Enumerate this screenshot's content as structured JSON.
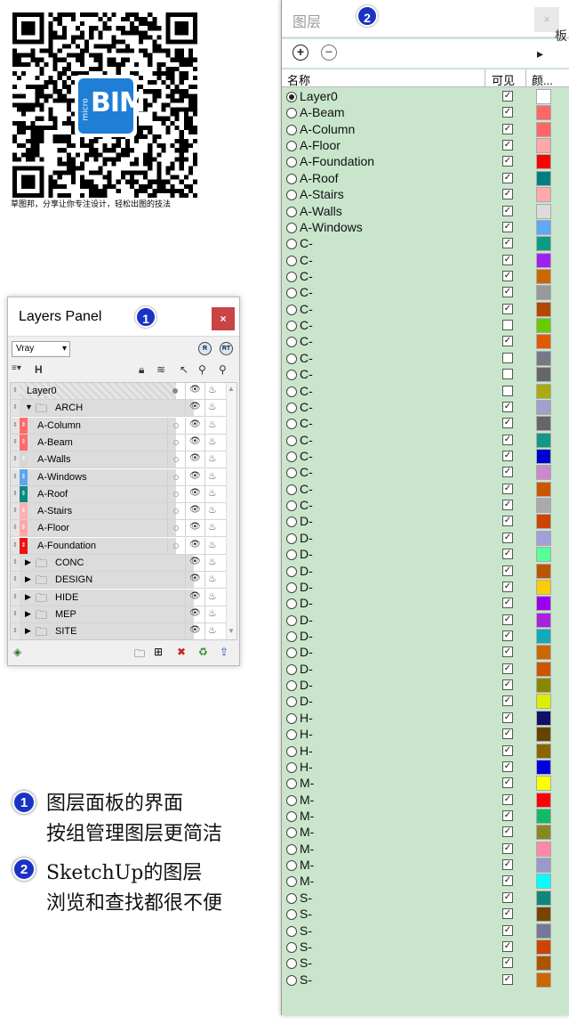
{
  "qr": {
    "logo_big": "BIM",
    "logo_small": "micro",
    "caption": "草图邦，分享让你专注设计，轻松出图的技法"
  },
  "layers_panel": {
    "title": "Layers Panel",
    "badge": "1",
    "close_label": "×",
    "renderer": "Vray",
    "render_buttons": [
      "R",
      "RT"
    ],
    "toolbar": {
      "menu": "≡▾",
      "filter": "H"
    },
    "footer_icons": [
      "layers-icon",
      "folder-icon",
      "add-layer-icon",
      "delete-icon",
      "purge-icon",
      "export-icon"
    ],
    "rows": [
      {
        "kind": "layer",
        "name": "Layer0",
        "indent": 0,
        "color": "#ffffff",
        "active": true
      },
      {
        "kind": "group",
        "name": "ARCH",
        "indent": 1,
        "expanded": true
      },
      {
        "kind": "layer",
        "name": "A-Column",
        "color": "#ff6b6b"
      },
      {
        "kind": "layer",
        "name": "A-Beam",
        "color": "#ff6b6b"
      },
      {
        "kind": "layer",
        "name": "A-Walls",
        "color": "#d6d6d6"
      },
      {
        "kind": "layer",
        "name": "A-Windows",
        "color": "#5aa6ef"
      },
      {
        "kind": "layer",
        "name": "A-Roof",
        "color": "#0a8a80"
      },
      {
        "kind": "layer",
        "name": "A-Stairs",
        "color": "#ffb0b0"
      },
      {
        "kind": "layer",
        "name": "A-Floor",
        "color": "#ffa6a6"
      },
      {
        "kind": "layer",
        "name": "A-Foundation",
        "color": "#ee1111"
      },
      {
        "kind": "group",
        "name": "CONC",
        "expanded": false
      },
      {
        "kind": "group",
        "name": "DESIGN",
        "expanded": false
      },
      {
        "kind": "group",
        "name": "HIDE",
        "expanded": false
      },
      {
        "kind": "group",
        "name": "MEP",
        "expanded": false
      },
      {
        "kind": "group",
        "name": "SITE",
        "expanded": false
      }
    ]
  },
  "notes": [
    {
      "badge": "1",
      "lines": [
        "图层面板的界面",
        "按组管理图层更简洁"
      ]
    },
    {
      "badge": "2",
      "lines": [
        "SketchUp的图层",
        "浏览和查找都很不便"
      ]
    }
  ],
  "sketchup_layers": {
    "title": "图层",
    "badge": "2",
    "close_label": "×",
    "add_label": "+",
    "remove_label": "−",
    "details_label": "▸",
    "columns": {
      "name": "名称",
      "visible": "可见",
      "color": "颜..."
    },
    "edge_fragment": "板",
    "layers": [
      {
        "name": "Layer0",
        "hidden": "",
        "visible": true,
        "color": "#ffffff",
        "active": true
      },
      {
        "name": "A-Beam",
        "hidden": "",
        "visible": true,
        "color": "#ff6666"
      },
      {
        "name": "A-Column",
        "hidden": "",
        "visible": true,
        "color": "#ff6666"
      },
      {
        "name": "A-Floor",
        "hidden": "",
        "visible": true,
        "color": "#ffa8a8"
      },
      {
        "name": "A-Foundation",
        "hidden": "",
        "visible": true,
        "color": "#ff0000"
      },
      {
        "name": "A-Roof",
        "hidden": "",
        "visible": true,
        "color": "#008080"
      },
      {
        "name": "A-Stairs",
        "hidden": "",
        "visible": true,
        "color": "#ffaaaa"
      },
      {
        "name": "A-Walls",
        "hidden": "",
        "visible": true,
        "color": "#dcdcdc"
      },
      {
        "name": "A-Windows",
        "hidden": "",
        "visible": true,
        "color": "#5fa8f5"
      },
      {
        "name": "C-",
        "hidden": "",
        "visible": true,
        "color": "#0b9b86"
      },
      {
        "name": "C-",
        "hidden": "",
        "visible": true,
        "color": "#a020f0"
      },
      {
        "name": "C-",
        "hidden": "",
        "visible": true,
        "color": "#cc6600"
      },
      {
        "name": "C-",
        "hidden": "",
        "visible": true,
        "color": "#999999"
      },
      {
        "name": "C-",
        "hidden": "",
        "visible": true,
        "color": "#b34700"
      },
      {
        "name": "C-",
        "hidden": "",
        "visible": false,
        "color": "#66cc00"
      },
      {
        "name": "C-",
        "hidden": "",
        "visible": true,
        "color": "#e05a00"
      },
      {
        "name": "C-",
        "hidden": "",
        "visible": false,
        "color": "#777788"
      },
      {
        "name": "C-",
        "hidden": "",
        "visible": false,
        "color": "#666666"
      },
      {
        "name": "C-",
        "hidden": "",
        "visible": false,
        "color": "#aaaa11"
      },
      {
        "name": "C-",
        "hidden": "",
        "visible": true,
        "color": "#a0a0cc"
      },
      {
        "name": "C-",
        "hidden": "",
        "visible": true,
        "color": "#666666"
      },
      {
        "name": "C-",
        "hidden": "",
        "visible": true,
        "color": "#119988"
      },
      {
        "name": "C-",
        "hidden": "",
        "visible": true,
        "color": "#0000cc"
      },
      {
        "name": "C-",
        "hidden": "",
        "visible": true,
        "color": "#cc88cc"
      },
      {
        "name": "C-",
        "hidden": "",
        "visible": true,
        "color": "#cc5500"
      },
      {
        "name": "C-",
        "hidden": "",
        "visible": true,
        "color": "#aaaaaa"
      },
      {
        "name": "D-",
        "hidden": "",
        "visible": true,
        "color": "#cc4400"
      },
      {
        "name": "D-",
        "hidden": "",
        "visible": true,
        "color": "#a0a0dd"
      },
      {
        "name": "D-",
        "hidden": "",
        "visible": true,
        "color": "#55ff99"
      },
      {
        "name": "D-",
        "hidden": "",
        "visible": true,
        "color": "#bb5500"
      },
      {
        "name": "D-",
        "hidden": "",
        "visible": true,
        "color": "#ffcc00"
      },
      {
        "name": "D-",
        "hidden": "",
        "visible": true,
        "color": "#9900ee"
      },
      {
        "name": "D-",
        "hidden": "",
        "visible": true,
        "color": "#aa22dd"
      },
      {
        "name": "D-",
        "hidden": "",
        "visible": true,
        "color": "#11aabb"
      },
      {
        "name": "D-",
        "hidden": "",
        "visible": true,
        "color": "#cc6600"
      },
      {
        "name": "D-",
        "hidden": "",
        "visible": true,
        "color": "#cc5500"
      },
      {
        "name": "D-",
        "hidden": "",
        "visible": true,
        "color": "#888800"
      },
      {
        "name": "D-",
        "hidden": "",
        "visible": true,
        "color": "#ddee00"
      },
      {
        "name": "H-",
        "hidden": "",
        "visible": true,
        "color": "#111166"
      },
      {
        "name": "H-",
        "hidden": "",
        "visible": true,
        "color": "#664400"
      },
      {
        "name": "H-",
        "hidden": "",
        "visible": true,
        "color": "#886600"
      },
      {
        "name": "H-",
        "hidden": "",
        "visible": true,
        "color": "#0000dd"
      },
      {
        "name": "M-",
        "hidden": "",
        "visible": true,
        "color": "#ffff00"
      },
      {
        "name": "M-",
        "hidden": "",
        "visible": true,
        "color": "#ff0000"
      },
      {
        "name": "M-",
        "hidden": "",
        "visible": true,
        "color": "#11bb66"
      },
      {
        "name": "M-",
        "hidden": "",
        "visible": true,
        "color": "#888822"
      },
      {
        "name": "M-",
        "hidden": "",
        "visible": true,
        "color": "#ff88aa"
      },
      {
        "name": "M-",
        "hidden": "",
        "visible": true,
        "color": "#9999cc"
      },
      {
        "name": "M-",
        "hidden": "",
        "visible": true,
        "color": "#00ffff"
      },
      {
        "name": "S-",
        "hidden": "",
        "visible": true,
        "color": "#118877"
      },
      {
        "name": "S-",
        "hidden": "",
        "visible": true,
        "color": "#774400"
      },
      {
        "name": "S-",
        "hidden": "",
        "visible": true,
        "color": "#777799"
      },
      {
        "name": "S-",
        "hidden": "",
        "visible": true,
        "color": "#cc4400"
      },
      {
        "name": "S-",
        "hidden": "",
        "visible": true,
        "color": "#aa5500"
      },
      {
        "name": "S-",
        "hidden": "",
        "visible": true,
        "color": "#cc6600"
      }
    ]
  }
}
